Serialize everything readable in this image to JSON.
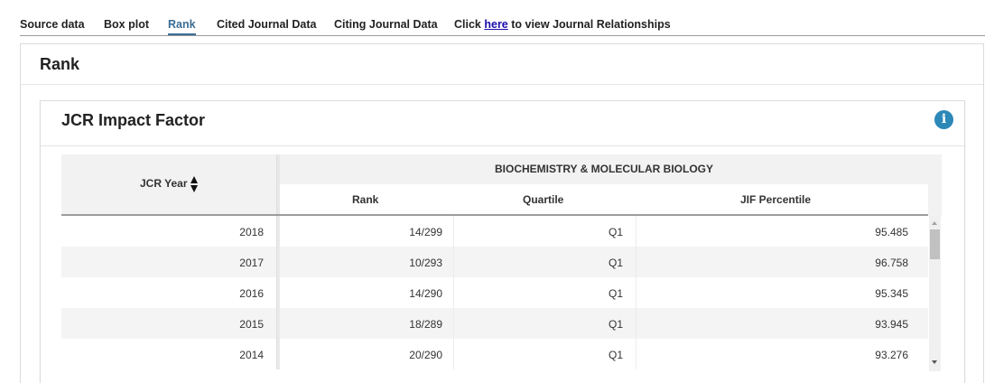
{
  "tabs": [
    {
      "label": "Source data"
    },
    {
      "label": "Box plot"
    },
    {
      "label": "Rank"
    },
    {
      "label": "Cited Journal Data"
    },
    {
      "label": "Citing Journal Data"
    }
  ],
  "relationship_tab": {
    "prefix": "Click ",
    "link": "here",
    "suffix": " to view Journal Relationships"
  },
  "active_tab": "Rank",
  "panel": {
    "title": "Rank"
  },
  "inner_panel": {
    "title": "JCR Impact Factor",
    "info_icon": "info-circle-icon"
  },
  "table": {
    "year_header": "JCR Year",
    "category": "BIOCHEMISTRY & MOLECULAR BIOLOGY",
    "columns": [
      "Rank",
      "Quartile",
      "JIF Percentile"
    ],
    "rows": [
      {
        "year": "2018",
        "rank": "14/299",
        "quartile": "Q1",
        "percentile": "95.485"
      },
      {
        "year": "2017",
        "rank": "10/293",
        "quartile": "Q1",
        "percentile": "96.758"
      },
      {
        "year": "2016",
        "rank": "14/290",
        "quartile": "Q1",
        "percentile": "95.345"
      },
      {
        "year": "2015",
        "rank": "18/289",
        "quartile": "Q1",
        "percentile": "93.945"
      },
      {
        "year": "2014",
        "rank": "20/290",
        "quartile": "Q1",
        "percentile": "93.276"
      }
    ]
  },
  "colors": {
    "accent": "#3a6d94",
    "info": "#2c88b7",
    "link": "#1a0dab"
  }
}
